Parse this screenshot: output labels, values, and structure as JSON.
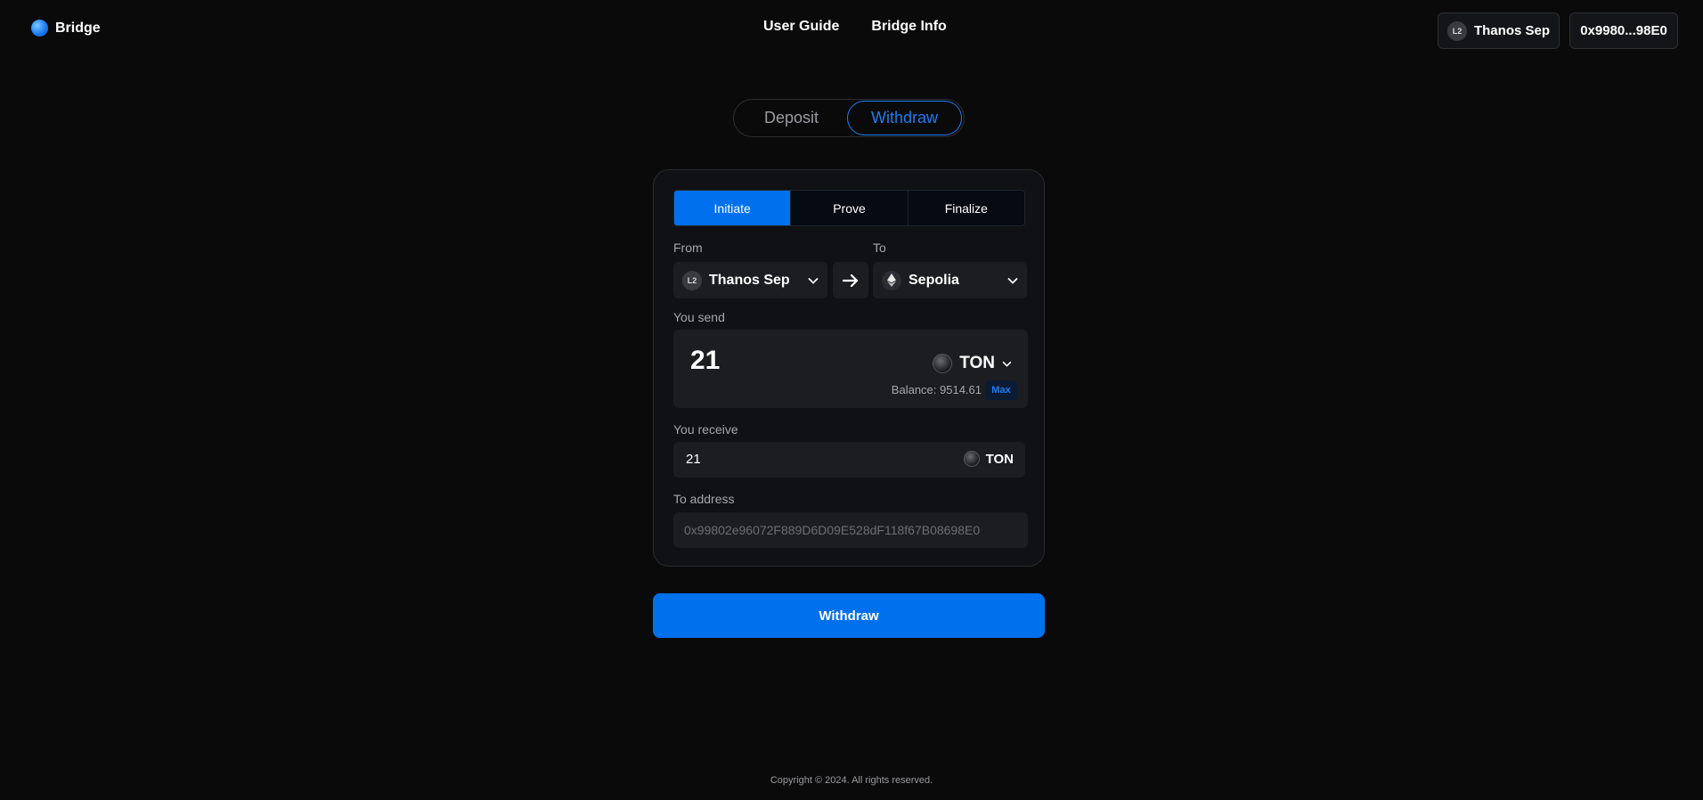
{
  "header": {
    "logo_text": "Bridge",
    "nav": [
      "User Guide",
      "Bridge Info"
    ],
    "network_badge": "L2",
    "network_label": "Thanos Sep",
    "wallet_address": "0x9980...98E0"
  },
  "mode_tabs": {
    "deposit": "Deposit",
    "withdraw": "Withdraw",
    "active": "Withdraw"
  },
  "steps": {
    "items": [
      "Initiate",
      "Prove",
      "Finalize"
    ],
    "active": "Initiate"
  },
  "from": {
    "label": "From",
    "badge": "L2",
    "chain": "Thanos Sep"
  },
  "to": {
    "label": "To",
    "chain": "Sepolia"
  },
  "send": {
    "label": "You send",
    "amount": "21",
    "token": "TON",
    "balance": "Balance: 9514.61",
    "max_label": "Max"
  },
  "receive": {
    "label": "You receive",
    "amount": "21",
    "token": "TON"
  },
  "to_address": {
    "label": "To address",
    "placeholder": "0x99802e96072F889D6D09E528dF118f67B08698E0"
  },
  "action_button": "Withdraw",
  "footer": "Copyright © 2024. All rights reserved.",
  "colors": {
    "accent": "#0070ed",
    "background": "#0a0a0a",
    "card": "#101114",
    "field": "#1c1d21"
  }
}
